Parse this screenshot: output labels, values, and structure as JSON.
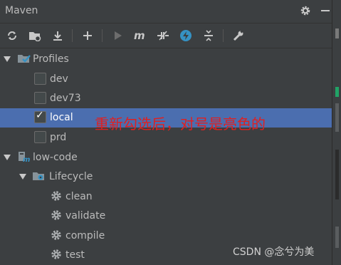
{
  "window": {
    "title": "Maven"
  },
  "toolbar": {
    "icons": [
      "refresh-icon",
      "add-folder-icon",
      "download-icon",
      "plus-icon",
      "run-icon",
      "maven-goal-icon",
      "toggle-offline-icon",
      "skip-tests-icon",
      "collapse-all-icon",
      "settings-wrench-icon"
    ]
  },
  "tree": {
    "profiles_label": "Profiles",
    "profiles": [
      {
        "label": "dev",
        "checked": false
      },
      {
        "label": "dev73",
        "checked": false
      },
      {
        "label": "local",
        "checked": true
      },
      {
        "label": "prd",
        "checked": false
      }
    ],
    "project_label": "low-code",
    "lifecycle_label": "Lifecycle",
    "lifecycle": [
      {
        "label": "clean"
      },
      {
        "label": "validate"
      },
      {
        "label": "compile"
      },
      {
        "label": "test"
      }
    ]
  },
  "annotation": "重新勾选后，对号是亮色的",
  "watermark": "CSDN @念兮为美",
  "colors": {
    "background": "#3c3f41",
    "selection": "#4b6eaf",
    "annotation": "#e02020",
    "blue_icon": "#3592c4"
  }
}
